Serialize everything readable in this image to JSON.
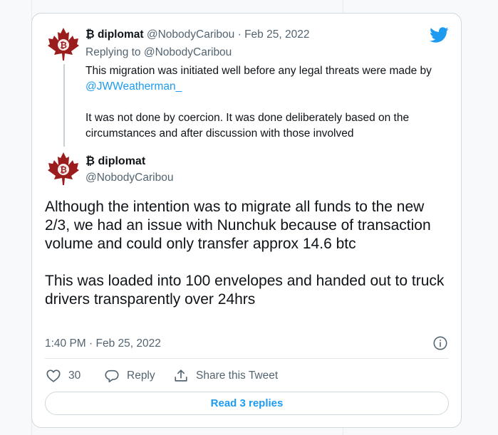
{
  "parent_tweet": {
    "display_name": "₿ diplomat",
    "handle": "@NobodyCaribou",
    "separator": "·",
    "date": "Feb 25, 2022",
    "replying_prefix": "Replying to",
    "replying_to": "@NobodyCaribou",
    "text_part1": "This migration was initiated well before any legal threats were made by ",
    "text_mention": "@JWWeatherman_",
    "text_part2": "It was not done by coercion. It was done deliberately based on the circumstances and after discussion with those involved"
  },
  "main_tweet": {
    "display_name": "₿ diplomat",
    "handle": "@NobodyCaribou",
    "paragraph1": "Although the intention was to migrate all funds to the new 2/3, we had an issue with Nunchuk because of transaction volume and could only transfer approx 14.6 btc",
    "paragraph2": "This was loaded into 100 envelopes and handed out to truck drivers transparently over 24hrs",
    "timestamp": "1:40 PM · Feb 25, 2022"
  },
  "actions": {
    "like_count": "30",
    "reply_label": "Reply",
    "share_label": "Share this Tweet",
    "read_replies_label": "Read 3 replies"
  },
  "icons": {
    "brand": "twitter-bird-icon",
    "avatar": "maple-leaf-bitcoin-icon",
    "like": "heart-icon",
    "reply": "speech-bubble-icon",
    "share": "share-upload-icon",
    "info": "info-icon"
  },
  "colors": {
    "accent": "#1d9bf0",
    "text": "#0f1419",
    "muted": "#536471",
    "leaf": "#9b1c1c",
    "background": "#f7f9fa"
  }
}
